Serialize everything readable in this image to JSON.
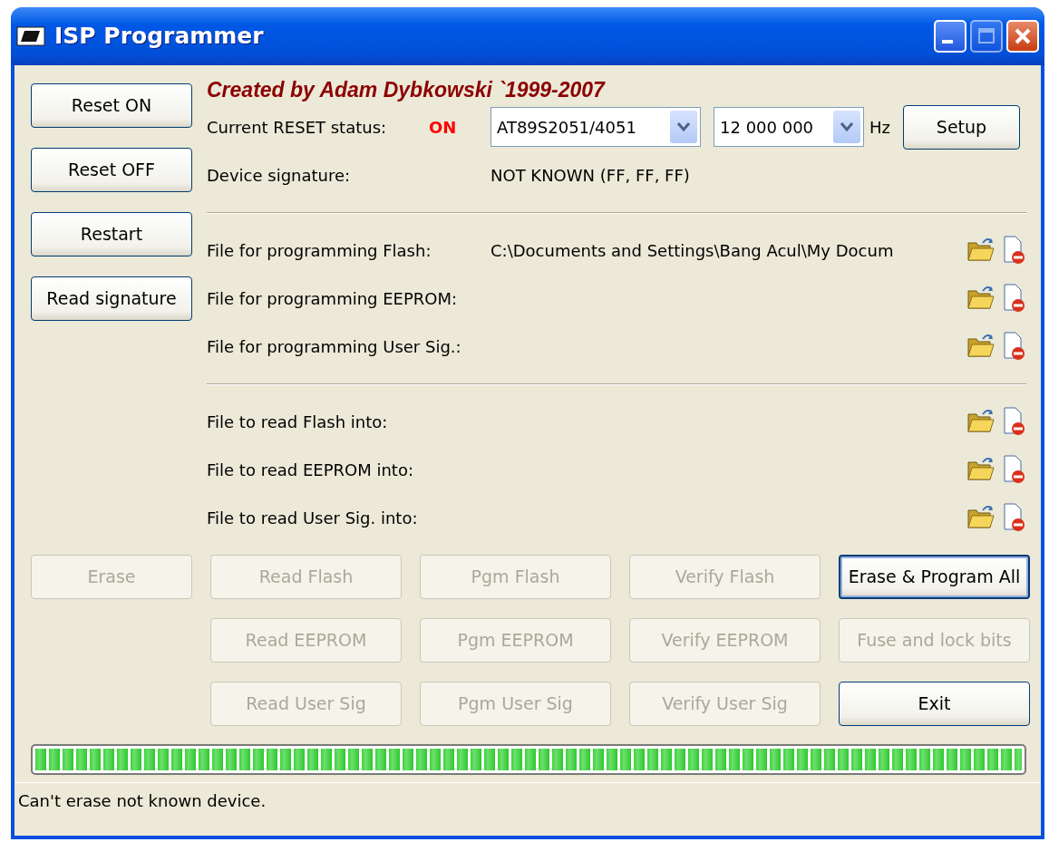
{
  "window": {
    "title": "ISP Programmer"
  },
  "side_buttons": [
    {
      "label": "Reset ON",
      "disabled": false
    },
    {
      "label": "Reset OFF",
      "disabled": false
    },
    {
      "label": "Restart",
      "disabled": false
    },
    {
      "label": "Read signature",
      "disabled": false
    }
  ],
  "credit": "Created by Adam Dybkowski `1999-2007",
  "reset_status": {
    "label": "Current RESET status:",
    "value": "ON"
  },
  "device": {
    "value": "AT89S2051/4051"
  },
  "frequency": {
    "value": "12 000 000",
    "unit": "Hz"
  },
  "setup_button": "Setup",
  "signature": {
    "label": "Device signature:",
    "value": "NOT KNOWN (FF, FF, FF)"
  },
  "write_files": [
    {
      "label": "File for programming Flash:",
      "path": "C:\\Documents and Settings\\Bang Acul\\My Docum"
    },
    {
      "label": "File for programming EEPROM:"
    },
    {
      "label": "File for programming User Sig.:"
    }
  ],
  "read_files": [
    {
      "label": "File to read Flash into:"
    },
    {
      "label": "File to read EEPROM into:"
    },
    {
      "label": "File to read User Sig. into:"
    }
  ],
  "action_rows": [
    [
      {
        "label": "Erase",
        "disabled": true,
        "default": false
      },
      {
        "label": "Read Flash",
        "disabled": true,
        "default": false
      },
      {
        "label": "Pgm Flash",
        "disabled": true,
        "default": false
      },
      {
        "label": "Verify Flash",
        "disabled": true,
        "default": false
      },
      {
        "label": "Erase & Program All",
        "disabled": false,
        "default": true
      }
    ],
    [
      {
        "label": "Read EEPROM",
        "disabled": true,
        "default": false
      },
      {
        "label": "Pgm EEPROM",
        "disabled": true,
        "default": false
      },
      {
        "label": "Verify EEPROM",
        "disabled": true,
        "default": false
      },
      {
        "label": "Fuse and lock bits",
        "disabled": true,
        "default": false
      }
    ],
    [
      {
        "label": "Read User Sig",
        "disabled": true,
        "default": false
      },
      {
        "label": "Pgm User Sig",
        "disabled": true,
        "default": false
      },
      {
        "label": "Verify User Sig",
        "disabled": true,
        "default": false
      },
      {
        "label": "Exit",
        "disabled": false,
        "default": false
      }
    ]
  ],
  "progress": {
    "level": 1.0
  },
  "status_bar": "Can't erase not known device."
}
